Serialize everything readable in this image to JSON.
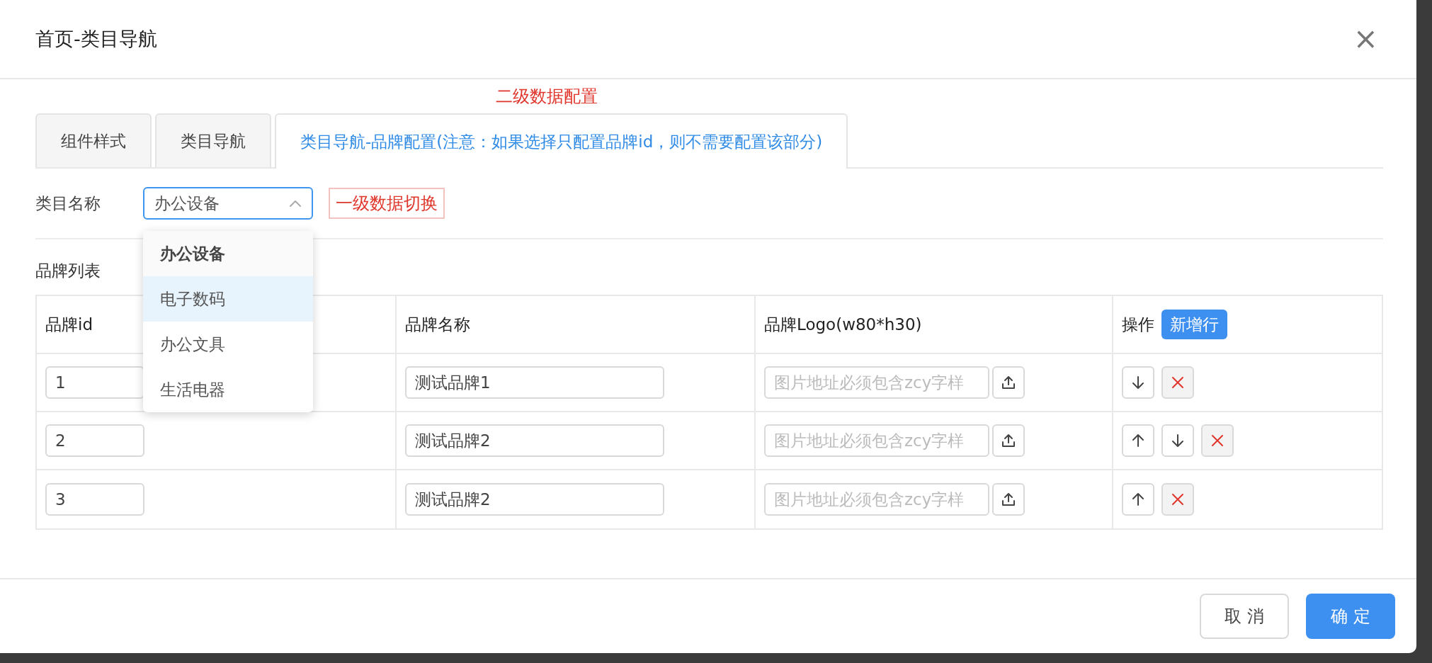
{
  "dialog": {
    "title": "首页-类目导航",
    "close": "×"
  },
  "annotations": {
    "tabs_note": "二级数据配置",
    "select_note": "一级数据切换"
  },
  "tabs": [
    {
      "label": "组件样式",
      "selected": false
    },
    {
      "label": "类目导航",
      "selected": false
    },
    {
      "label": "类目导航-品牌配置(注意：如果选择只配置品牌id，则不需要配置该部分)",
      "selected": true
    }
  ],
  "category": {
    "label": "类目名称",
    "value": "办公设备",
    "expanded": true,
    "options": [
      {
        "label": "办公设备",
        "selected": true,
        "highlighted": false
      },
      {
        "label": "电子数码",
        "selected": false,
        "highlighted": true
      },
      {
        "label": "办公文具",
        "selected": false,
        "highlighted": false
      },
      {
        "label": "生活电器",
        "selected": false,
        "highlighted": false
      }
    ]
  },
  "brand_list": {
    "title": "品牌列表",
    "columns": [
      "品牌id",
      "品牌名称",
      "品牌Logo(w80*h30)",
      "操作"
    ],
    "add_row_button": "新增行",
    "rows": [
      {
        "id": "1",
        "name": "测试品牌1",
        "logo_placeholder": "图片地址必须包含zcy字样",
        "actions": [
          {
            "kind": "down"
          },
          {
            "kind": "delete"
          }
        ]
      },
      {
        "id": "2",
        "name": "测试品牌2",
        "logo_placeholder": "图片地址必须包含zcy字样",
        "actions": [
          {
            "kind": "up"
          },
          {
            "kind": "down"
          },
          {
            "kind": "delete"
          }
        ]
      },
      {
        "id": "3",
        "name": "测试品牌2",
        "logo_placeholder": "图片地址必须包含zcy字样",
        "actions": [
          {
            "kind": "up"
          },
          {
            "kind": "delete"
          }
        ]
      }
    ]
  },
  "footer": {
    "cancel": "取 消",
    "confirm": "确 定"
  }
}
